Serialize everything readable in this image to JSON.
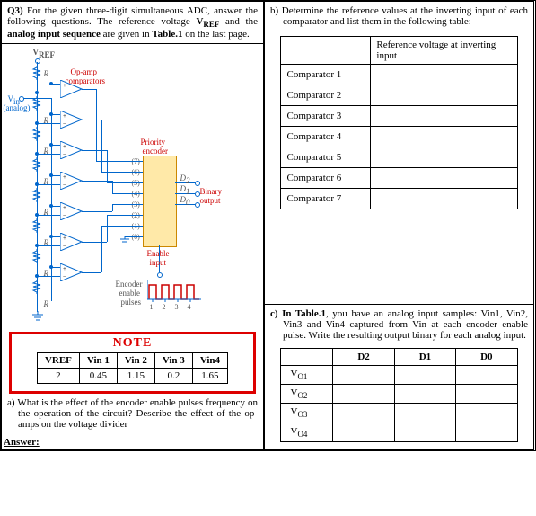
{
  "q3": {
    "heading": "Q3)",
    "intro_1": " For the given three-digit simultaneous ADC, answer the following questions. The reference voltage ",
    "vref": "VREF",
    "intro_2": " and the ",
    "bold2": "analog input sequence",
    "intro_3": " are given in ",
    "tbl1": "Table.1",
    "intro_4": " on the last page."
  },
  "circuit": {
    "vref": "VREF",
    "opamp": "Op-amp",
    "comp_lbl": "comparators",
    "vin": "Vin",
    "analog": "(analog)",
    "R": "R",
    "encoder": "Priority",
    "encoder2": "encoder",
    "pins": [
      "(7)",
      "(6)",
      "(5)",
      "(4)",
      "(3)",
      "(2)",
      "(1)",
      "(0)"
    ],
    "d2": "D2",
    "d1": "D1",
    "d0": "D0",
    "binout": "Binary",
    "binout2": "output",
    "enable": "Enable",
    "enable2": "input",
    "encpulse1": "Encoder",
    "encpulse2": "enable",
    "encpulse3": "pulses",
    "ticks": [
      "1",
      "2",
      "3",
      "4"
    ]
  },
  "note": {
    "title": "NOTE",
    "headers": [
      "VREF",
      "Vin 1",
      "Vin 2",
      "Vin 3",
      "Vin4"
    ],
    "rows": [
      [
        "2",
        "0.45",
        "1.15",
        "0.2",
        "1.65"
      ]
    ]
  },
  "part_a": {
    "label": "a)",
    "text": "What is the effect of the encoder enable pulses frequency on the operation of the circuit? Describe the effect of the op-amps on the voltage divider"
  },
  "answer_label": "Answer:",
  "part_b": {
    "label": "b)",
    "text": "Determine the reference values at the inverting input of each comparator and list them in the following table:",
    "header": "Reference voltage at inverting input",
    "rows": [
      "Comparator 1",
      "Comparator 2",
      "Comparator 3",
      "Comparator 4",
      "Comparator 5",
      "Comparator 6",
      "Comparator 7"
    ]
  },
  "part_c": {
    "label": "c)",
    "lead": "In Table.1",
    "text": ", you have an analog input samples: Vin1, Vin2, Vin3 and Vin4 captured from Vin at each encoder enable pulse. Write the resulting output binary for each analog input.",
    "headers": [
      "D2",
      "D1",
      "D0"
    ],
    "rows": [
      "VO1",
      "VO2",
      "VO3",
      "VO4"
    ]
  }
}
